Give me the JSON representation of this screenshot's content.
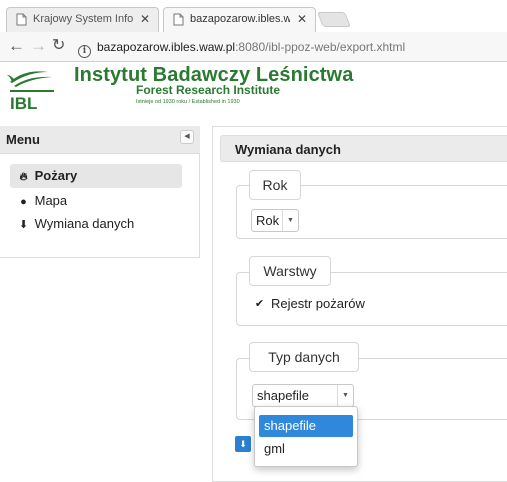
{
  "browser": {
    "tabs": [
      {
        "title": "Krajowy System Informac",
        "active": false
      },
      {
        "title": "bazapozarow.ibles.waw.p",
        "active": true
      }
    ],
    "address": {
      "host": "bazapozarow.ibles.waw.pl",
      "path": ":8080/ibl-ppoz-web/export.xhtml"
    }
  },
  "header": {
    "logo_text": "IBL",
    "org_name": "Instytut Badawczy Leśnictwa",
    "org_subtitle": "Forest Research Institute",
    "established": "Istnieje od 1930 roku / Established in 1930",
    "brand_color": "#2a7a31"
  },
  "sidebar": {
    "title": "Menu",
    "items": [
      {
        "label": "Pożary",
        "icon": "fire-icon",
        "selected": true
      },
      {
        "label": "Mapa",
        "icon": "globe-icon",
        "selected": false
      },
      {
        "label": "Wymiana danych",
        "icon": "download-icon",
        "selected": false
      }
    ]
  },
  "main": {
    "title": "Wymiana danych",
    "sections": {
      "rok": {
        "legend": "Rok",
        "select_value": "Rok"
      },
      "warstwy": {
        "legend": "Warstwy",
        "checkbox_label": "Rejestr pożarów",
        "checked": true
      },
      "typ": {
        "legend": "Typ danych",
        "select_value": "shapefile",
        "options": [
          "shapefile",
          "gml"
        ],
        "highlighted_option": "shapefile"
      }
    }
  },
  "colors": {
    "accent": "#2f88dc",
    "panel_header": "#ebebeb"
  }
}
